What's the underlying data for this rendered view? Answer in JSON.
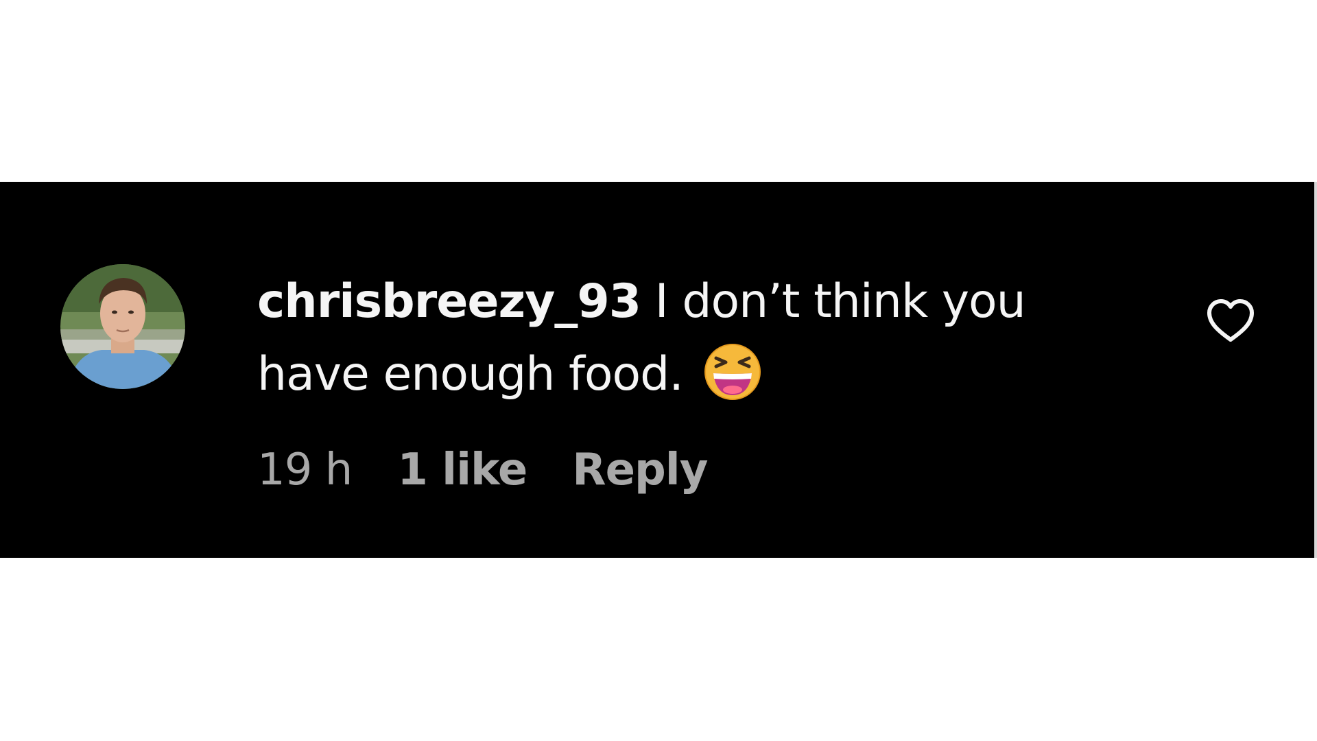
{
  "comment": {
    "username": "chrisbreezy_93",
    "text_line1": " I don’t think you",
    "text_line2": "have enough food.",
    "emoji": "squinting-laughing-face",
    "timestamp": "19 h",
    "likes": "1 like",
    "reply_label": "Reply"
  },
  "icons": {
    "like": "heart-outline-icon"
  },
  "colors": {
    "card_background": "#000000",
    "primary_text": "#f5f5f5",
    "secondary_text": "#a8a8a8",
    "emoji_yellow": "#f6b93b",
    "emoji_mouth": "#c13584"
  }
}
